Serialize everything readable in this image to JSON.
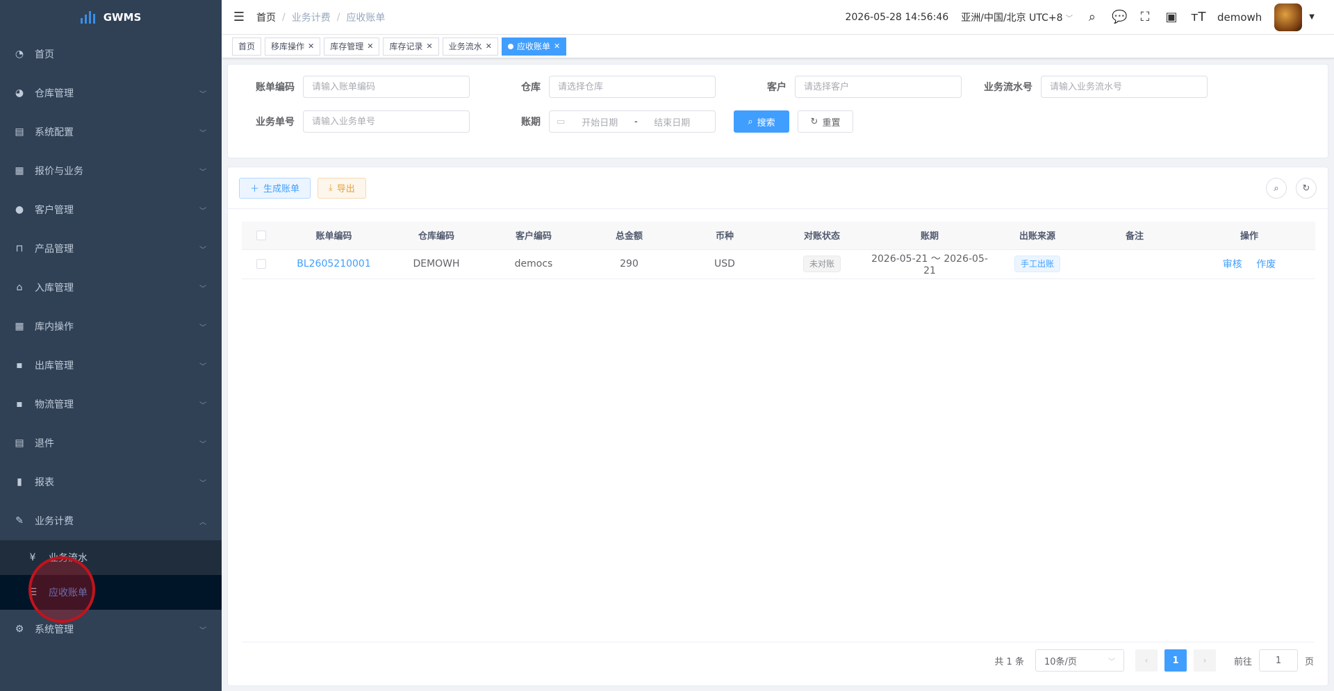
{
  "app": {
    "name": "GWMS"
  },
  "sidebar": {
    "items": [
      {
        "label": "首页",
        "icon": "dashboard-icon",
        "glyph": "◔"
      },
      {
        "label": "仓库管理",
        "icon": "globe-icon",
        "glyph": "◕"
      },
      {
        "label": "系统配置",
        "icon": "monitor-icon",
        "glyph": "▤"
      },
      {
        "label": "报价与业务",
        "icon": "document-icon",
        "glyph": "▦"
      },
      {
        "label": "客户管理",
        "icon": "user-icon",
        "glyph": "●"
      },
      {
        "label": "产品管理",
        "icon": "cart-icon",
        "glyph": "⊓"
      },
      {
        "label": "入库管理",
        "icon": "home-icon",
        "glyph": "⌂"
      },
      {
        "label": "库内操作",
        "icon": "grid-icon",
        "glyph": "▦"
      },
      {
        "label": "出库管理",
        "icon": "apps-icon",
        "glyph": "▪"
      },
      {
        "label": "物流管理",
        "icon": "apps-icon",
        "glyph": "▪"
      },
      {
        "label": "退件",
        "icon": "document-icon",
        "glyph": "▤"
      },
      {
        "label": "报表",
        "icon": "bar-chart-icon",
        "glyph": "▮"
      },
      {
        "label": "业务计费",
        "icon": "edit-icon",
        "glyph": "✎"
      }
    ],
    "billing_sub": [
      {
        "label": "业务流水",
        "icon": "yen-icon",
        "glyph": "¥"
      },
      {
        "label": "应收账单",
        "icon": "list-icon",
        "glyph": "☰"
      }
    ],
    "last_item": {
      "label": "系统管理",
      "icon": "gear-icon",
      "glyph": "⚙"
    }
  },
  "navbar": {
    "breadcrumb": [
      "首页",
      "业务计费",
      "应收账单"
    ],
    "datetime": "2026-05-28 14:56:46",
    "timezone": "亚洲/中国/北京 UTC+8",
    "username": "demowh"
  },
  "tags": [
    {
      "label": "首页",
      "closable": false
    },
    {
      "label": "移库操作",
      "closable": true
    },
    {
      "label": "库存管理",
      "closable": true
    },
    {
      "label": "库存记录",
      "closable": true
    },
    {
      "label": "业务流水",
      "closable": true
    },
    {
      "label": "应收账单",
      "closable": true,
      "active": true
    }
  ],
  "search": {
    "bill_code_label": "账单编码",
    "bill_code_placeholder": "请输入账单编码",
    "warehouse_label": "仓库",
    "warehouse_placeholder": "请选择仓库",
    "customer_label": "客户",
    "customer_placeholder": "请选择客户",
    "flow_no_label": "业务流水号",
    "flow_no_placeholder": "请输入业务流水号",
    "biz_no_label": "业务单号",
    "biz_no_placeholder": "请输入业务单号",
    "period_label": "账期",
    "start_placeholder": "开始日期",
    "range_sep": "-",
    "end_placeholder": "结束日期",
    "search_btn": "搜索",
    "reset_btn": "重置"
  },
  "toolbar": {
    "generate_btn": "生成账单",
    "export_btn": "导出"
  },
  "table": {
    "columns": [
      "账单编码",
      "仓库编码",
      "客户编码",
      "总金额",
      "币种",
      "对账状态",
      "账期",
      "出账来源",
      "备注",
      "操作"
    ],
    "rows": [
      {
        "bill_code": "BL2605210001",
        "warehouse": "DEMOWH",
        "customer": "democs",
        "amount": "290",
        "currency": "USD",
        "status": "未对账",
        "period": "2026-05-21 ～ 2026-05-21",
        "source": "手工出账",
        "remark": "",
        "actions": [
          "审核",
          "作废"
        ]
      }
    ]
  },
  "pagination": {
    "total_text": "共 1 条",
    "page_size": "10条/页",
    "current_page": "1",
    "goto_label": "前往",
    "goto_value": "1",
    "page_unit": "页"
  },
  "colors": {
    "sidebar_bg": "#304156",
    "primary": "#409eff",
    "submenu_bg": "#1f2d3d",
    "active_sub_bg": "#001528"
  }
}
